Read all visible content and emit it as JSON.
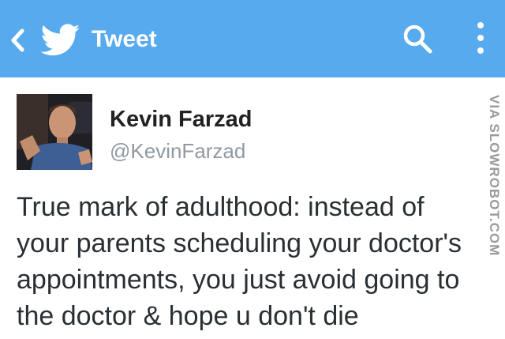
{
  "appbar": {
    "title": "Tweet",
    "background_color": "#56aaed",
    "back_icon": "chevron-left-icon",
    "logo_icon": "twitter-bird-icon",
    "search_icon": "search-icon",
    "overflow_icon": "more-vertical-icon"
  },
  "tweet": {
    "author_name": "Kevin Farzad",
    "author_handle": "@KevinFarzad",
    "text_lines": [
      "True mark of adulthood: instead of",
      "your parents scheduling your doctor's",
      "appointments, you just avoid going to",
      "the doctor & hope u don't die"
    ]
  },
  "watermark": {
    "text": "VIA SLOWROBOT.COM"
  }
}
